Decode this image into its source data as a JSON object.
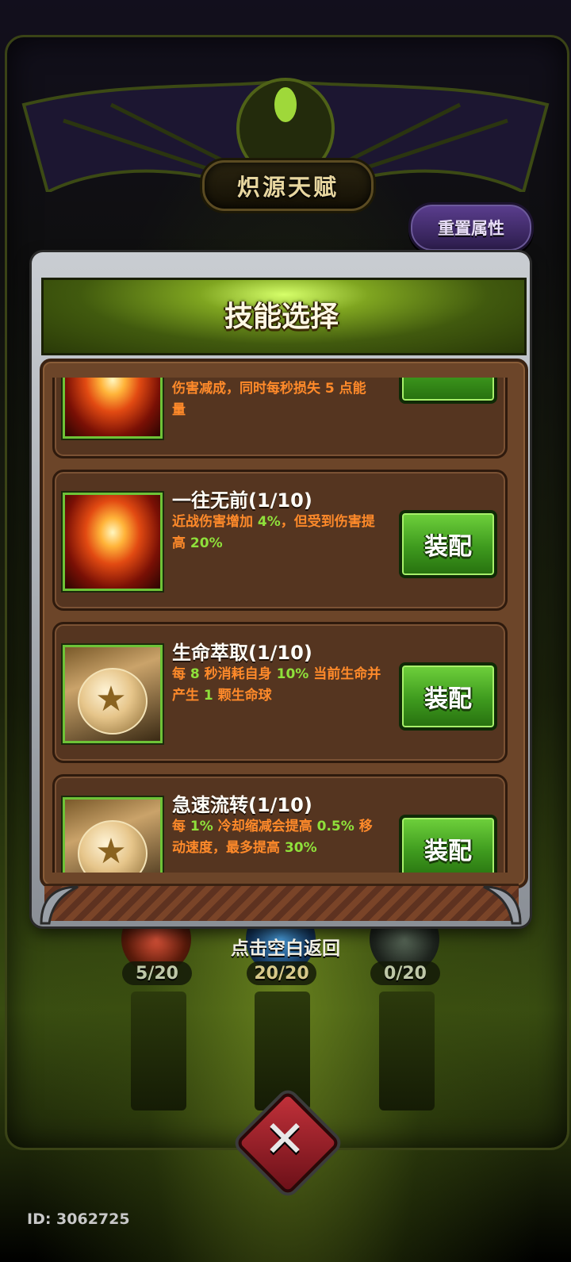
{
  "header": {
    "title": "炽源天赋",
    "reset_label": "重置属性"
  },
  "modal": {
    "title": "技能选择",
    "partial_card": {
      "desc_line1": "伤害减成，同时每秒损失 5 点能",
      "desc_line2": "量"
    },
    "skills": [
      {
        "name": "一往无前(1/10)",
        "icon": "fire-burst-icon",
        "desc": [
          {
            "t": "近战伤害增加 ",
            "c": "orange"
          },
          {
            "t": "4%",
            "c": "green"
          },
          {
            "t": "，但受到伤害提高 ",
            "c": "orange"
          },
          {
            "t": "20%",
            "c": "green"
          }
        ],
        "button": "装配"
      },
      {
        "name": "生命萃取(1/10)",
        "icon": "star-orb-icon",
        "desc": [
          {
            "t": "每 ",
            "c": "orange"
          },
          {
            "t": "8",
            "c": "green"
          },
          {
            "t": " 秒消耗自身 ",
            "c": "orange"
          },
          {
            "t": "10%",
            "c": "green"
          },
          {
            "t": " 当前生命并产生 ",
            "c": "orange"
          },
          {
            "t": "1",
            "c": "green"
          },
          {
            "t": " 颗生命球",
            "c": "orange"
          }
        ],
        "button": "装配"
      },
      {
        "name": "急速流转(1/10)",
        "icon": "star-orb-icon",
        "desc": [
          {
            "t": "每 ",
            "c": "orange"
          },
          {
            "t": "1%",
            "c": "green"
          },
          {
            "t": " 冷却缩减会提高 ",
            "c": "orange"
          },
          {
            "t": "0.5%",
            "c": "green"
          },
          {
            "t": " 移动速度，最多提高 ",
            "c": "orange"
          },
          {
            "t": "30%",
            "c": "green"
          }
        ],
        "button": "装配"
      }
    ],
    "tap_hint": "点击空白返回"
  },
  "counters": [
    "5/20",
    "20/20",
    "0/20"
  ],
  "footer": {
    "id_text": "ID: 3062725"
  },
  "colors": {
    "orange": "#ff8a2a",
    "green": "#8fe03b",
    "equip_green": "#4caf24",
    "reset_purple": "#4a3278"
  }
}
